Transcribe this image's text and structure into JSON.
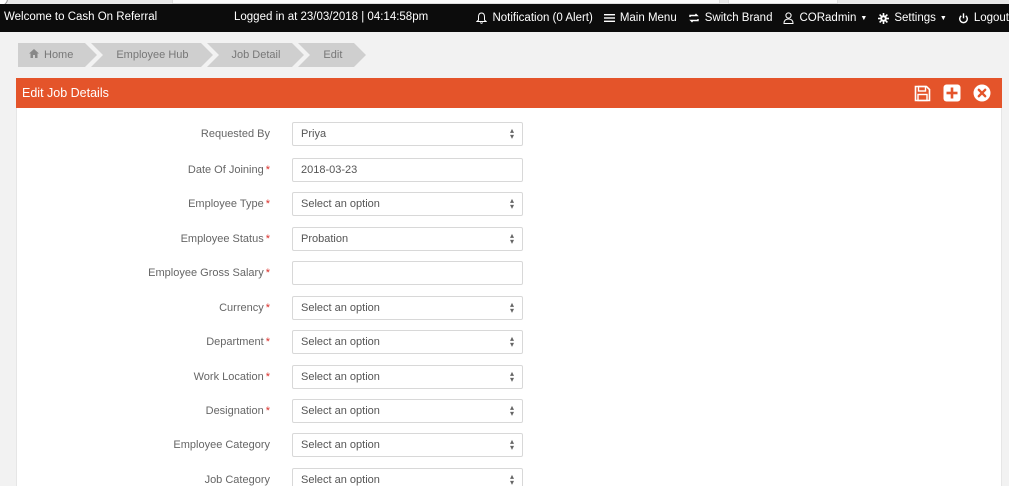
{
  "header": {
    "welcome": "Welcome to Cash On Referral",
    "logged_in": "Logged in at 23/03/2018 | 04:14:58pm",
    "notification": "Notification (0 Alert)",
    "main_menu": "Main Menu",
    "switch_brand": "Switch Brand",
    "user": "CORadmin",
    "settings": "Settings",
    "logout": "Logout"
  },
  "breadcrumb": [
    "Home",
    "Employee Hub",
    "Job Detail",
    "Edit"
  ],
  "panel": {
    "title": "Edit Job Details",
    "accent": "#e4542a"
  },
  "form": [
    {
      "label": "Requested By",
      "required": false,
      "type": "select",
      "value": "Priya"
    },
    {
      "label": "Date Of Joining",
      "required": true,
      "type": "input",
      "value": "2018-03-23"
    },
    {
      "label": "Employee Type",
      "required": true,
      "type": "select",
      "value": "Select an option"
    },
    {
      "label": "Employee Status",
      "required": true,
      "type": "select",
      "value": "Probation"
    },
    {
      "label": "Employee Gross Salary",
      "required": true,
      "type": "input",
      "value": ""
    },
    {
      "label": "Currency",
      "required": true,
      "type": "select",
      "value": "Select an option"
    },
    {
      "label": "Department",
      "required": true,
      "type": "select",
      "value": "Select an option"
    },
    {
      "label": "Work Location",
      "required": true,
      "type": "select",
      "value": "Select an option"
    },
    {
      "label": "Designation",
      "required": true,
      "type": "select",
      "value": "Select an option"
    },
    {
      "label": "Employee Category",
      "required": false,
      "type": "select",
      "value": "Select an option"
    },
    {
      "label": "Job Category",
      "required": false,
      "type": "select",
      "value": "Select an option"
    }
  ],
  "required_mark": "*"
}
